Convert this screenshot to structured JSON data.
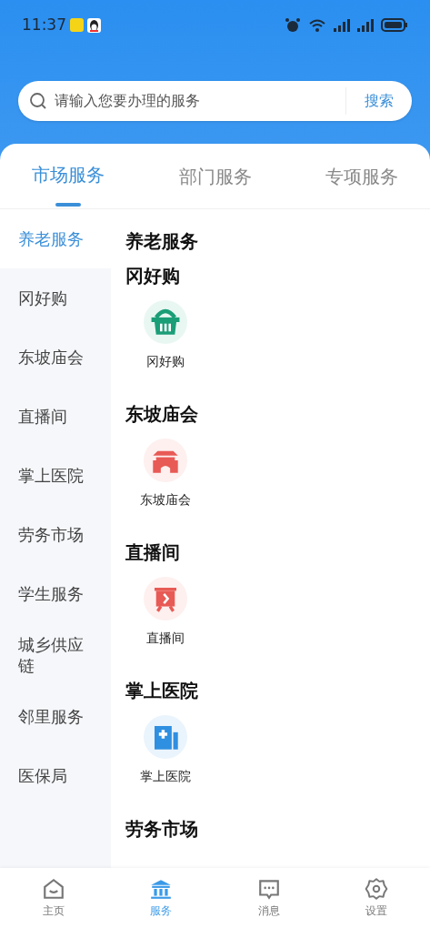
{
  "status_bar": {
    "time": "11:37"
  },
  "search": {
    "placeholder": "请输入您要办理的服务",
    "button": "搜索"
  },
  "tabs": [
    {
      "label": "市场服务",
      "selected": true
    },
    {
      "label": "部门服务",
      "selected": false
    },
    {
      "label": "专项服务",
      "selected": false
    }
  ],
  "sidebar": {
    "items": [
      {
        "label": "养老服务",
        "selected": true
      },
      {
        "label": "冈好购",
        "selected": false
      },
      {
        "label": "东坡庙会",
        "selected": false
      },
      {
        "label": "直播间",
        "selected": false
      },
      {
        "label": "掌上医院",
        "selected": false
      },
      {
        "label": "劳务市场",
        "selected": false
      },
      {
        "label": "学生服务",
        "selected": false
      },
      {
        "label": "城乡供应链",
        "selected": false
      },
      {
        "label": "邻里服务",
        "selected": false
      },
      {
        "label": "医保局",
        "selected": false
      }
    ]
  },
  "sections": [
    {
      "title": "养老服务"
    },
    {
      "title": "冈好购",
      "items": [
        {
          "label": "冈好购",
          "kind": "basket",
          "color": "#1a9e78"
        }
      ]
    },
    {
      "title": "东坡庙会",
      "items": [
        {
          "label": "东坡庙会",
          "kind": "gate",
          "color": "#e85a55"
        }
      ]
    },
    {
      "title": "直播间",
      "items": [
        {
          "label": "直播间",
          "kind": "screen",
          "color": "#e85a55"
        }
      ]
    },
    {
      "title": "掌上医院",
      "items": [
        {
          "label": "掌上医院",
          "kind": "hospital",
          "color": "#2f8fe0"
        }
      ]
    },
    {
      "title": "劳务市场"
    }
  ],
  "bottom_nav": [
    {
      "label": "主页",
      "kind": "home",
      "selected": false
    },
    {
      "label": "服务",
      "kind": "bank",
      "selected": true
    },
    {
      "label": "消息",
      "kind": "chat",
      "selected": false
    },
    {
      "label": "设置",
      "kind": "gear",
      "selected": false
    }
  ]
}
